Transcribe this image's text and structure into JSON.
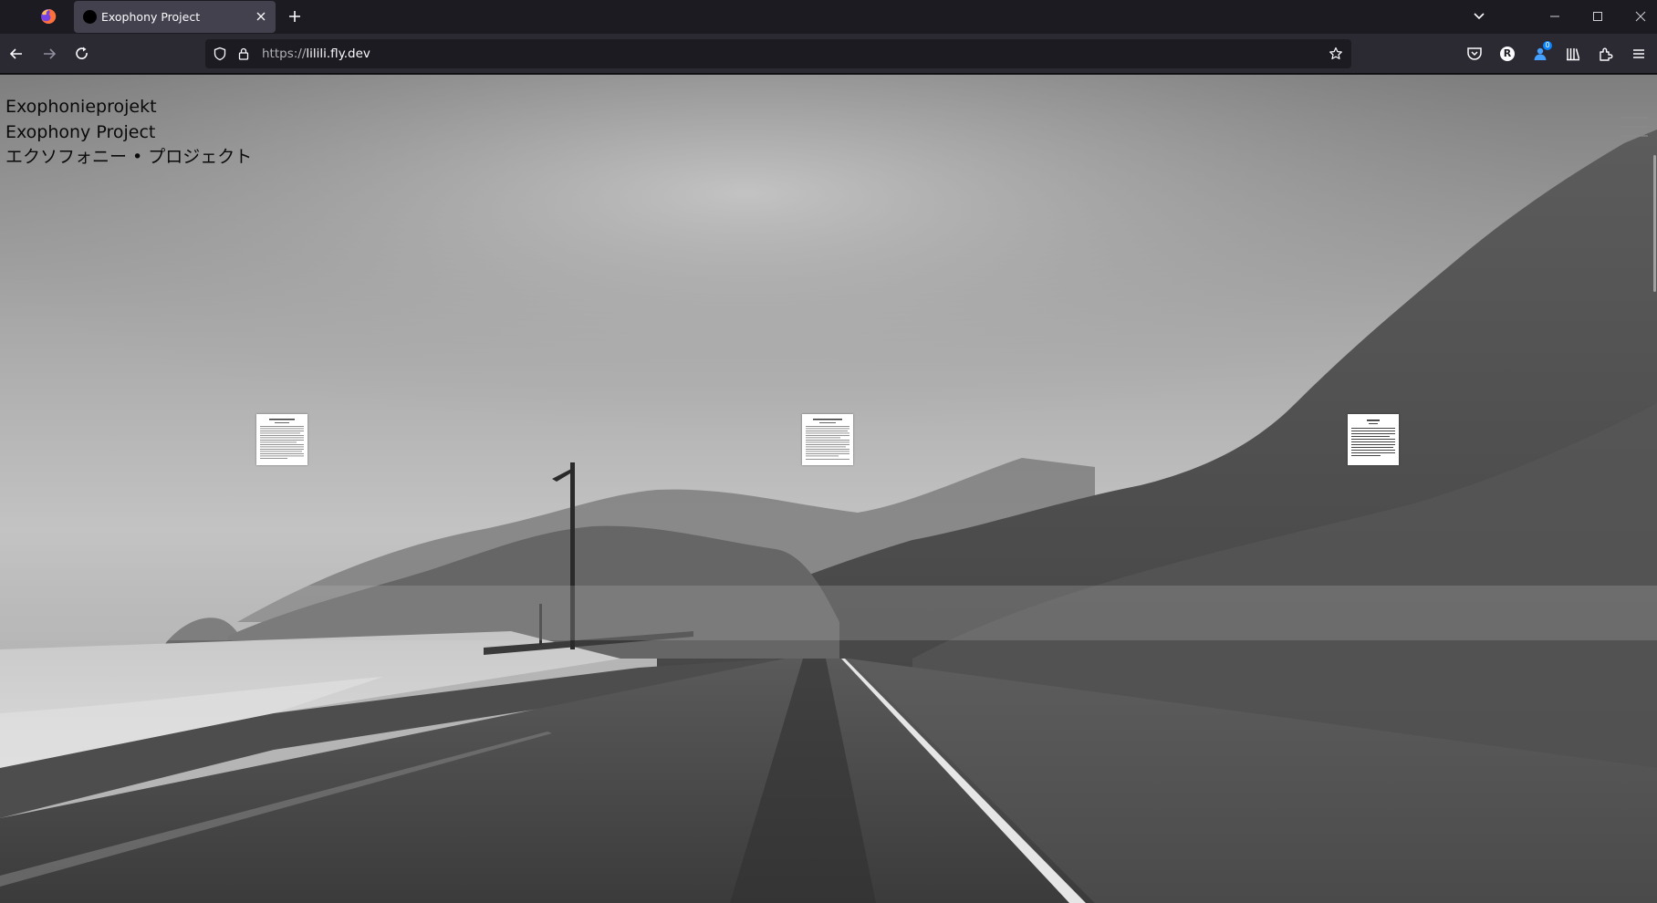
{
  "browser": {
    "tab": {
      "title": "Exophony Project"
    },
    "url": {
      "scheme": "https://",
      "host": "lilili.fly.dev"
    },
    "toolbar": {
      "extension_badge": "0",
      "account_letter": "R"
    },
    "icons": [
      "firefox-icon",
      "close-icon",
      "plus-icon",
      "chevron-down-icon",
      "back-arrow-icon",
      "forward-arrow-icon",
      "reload-icon",
      "shield-icon",
      "lock-icon",
      "star-icon",
      "pocket-icon",
      "account-icon",
      "extension-icon",
      "library-icon",
      "puzzle-icon",
      "menu-icon"
    ]
  },
  "page": {
    "titles": [
      "Exophonieprojekt",
      "Exophony Project",
      "エクソフォニー • プロジェクト"
    ],
    "documents": [
      {
        "name": "document-thumbnail-1"
      },
      {
        "name": "document-thumbnail-2"
      },
      {
        "name": "document-thumbnail-3"
      }
    ]
  }
}
